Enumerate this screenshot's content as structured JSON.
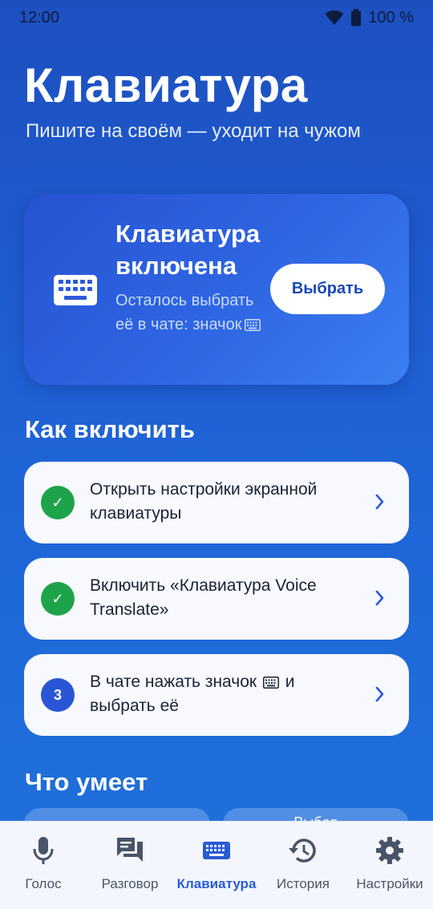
{
  "status": {
    "time": "12:00",
    "battery": "100 %"
  },
  "header": {
    "title": "Клавиатура",
    "subtitle": "Пишите на своём — уходит на чужом"
  },
  "hero": {
    "title": "Клавиатура включена",
    "description": "Осталось выбрать её в чате: значок",
    "button_label": "Выбрать",
    "icon": "keyboard-icon"
  },
  "how_to": {
    "title": "Как включить",
    "steps": [
      {
        "status": "done",
        "badge": "✓",
        "text": "Открыть настройки экранной клавиатуры"
      },
      {
        "status": "done",
        "badge": "✓",
        "text": "Включить «Клавиатура Voice Translate»"
      },
      {
        "status": "pending",
        "badge": "3",
        "text_before": "В чате нажать значок",
        "text_after": "и выбрать её"
      }
    ]
  },
  "capabilities": {
    "title": "Что умеет",
    "items": [
      {
        "label": ""
      },
      {
        "label": "Выбор"
      }
    ]
  },
  "bottom_nav": {
    "active": "keyboard",
    "items": [
      {
        "id": "voice",
        "label": "Голос",
        "icon": "microphone-icon"
      },
      {
        "id": "conversation",
        "label": "Разговор",
        "icon": "chat-icon"
      },
      {
        "id": "keyboard",
        "label": "Клавиатура",
        "icon": "keyboard-icon"
      },
      {
        "id": "history",
        "label": "История",
        "icon": "history-icon"
      },
      {
        "id": "settings",
        "label": "Настройки",
        "icon": "gear-icon"
      }
    ]
  },
  "colors": {
    "accent": "#2a5bd7",
    "done": "#1fa34a",
    "card_bg": "#f7f9fe",
    "nav_bg": "#f3f6fc"
  }
}
